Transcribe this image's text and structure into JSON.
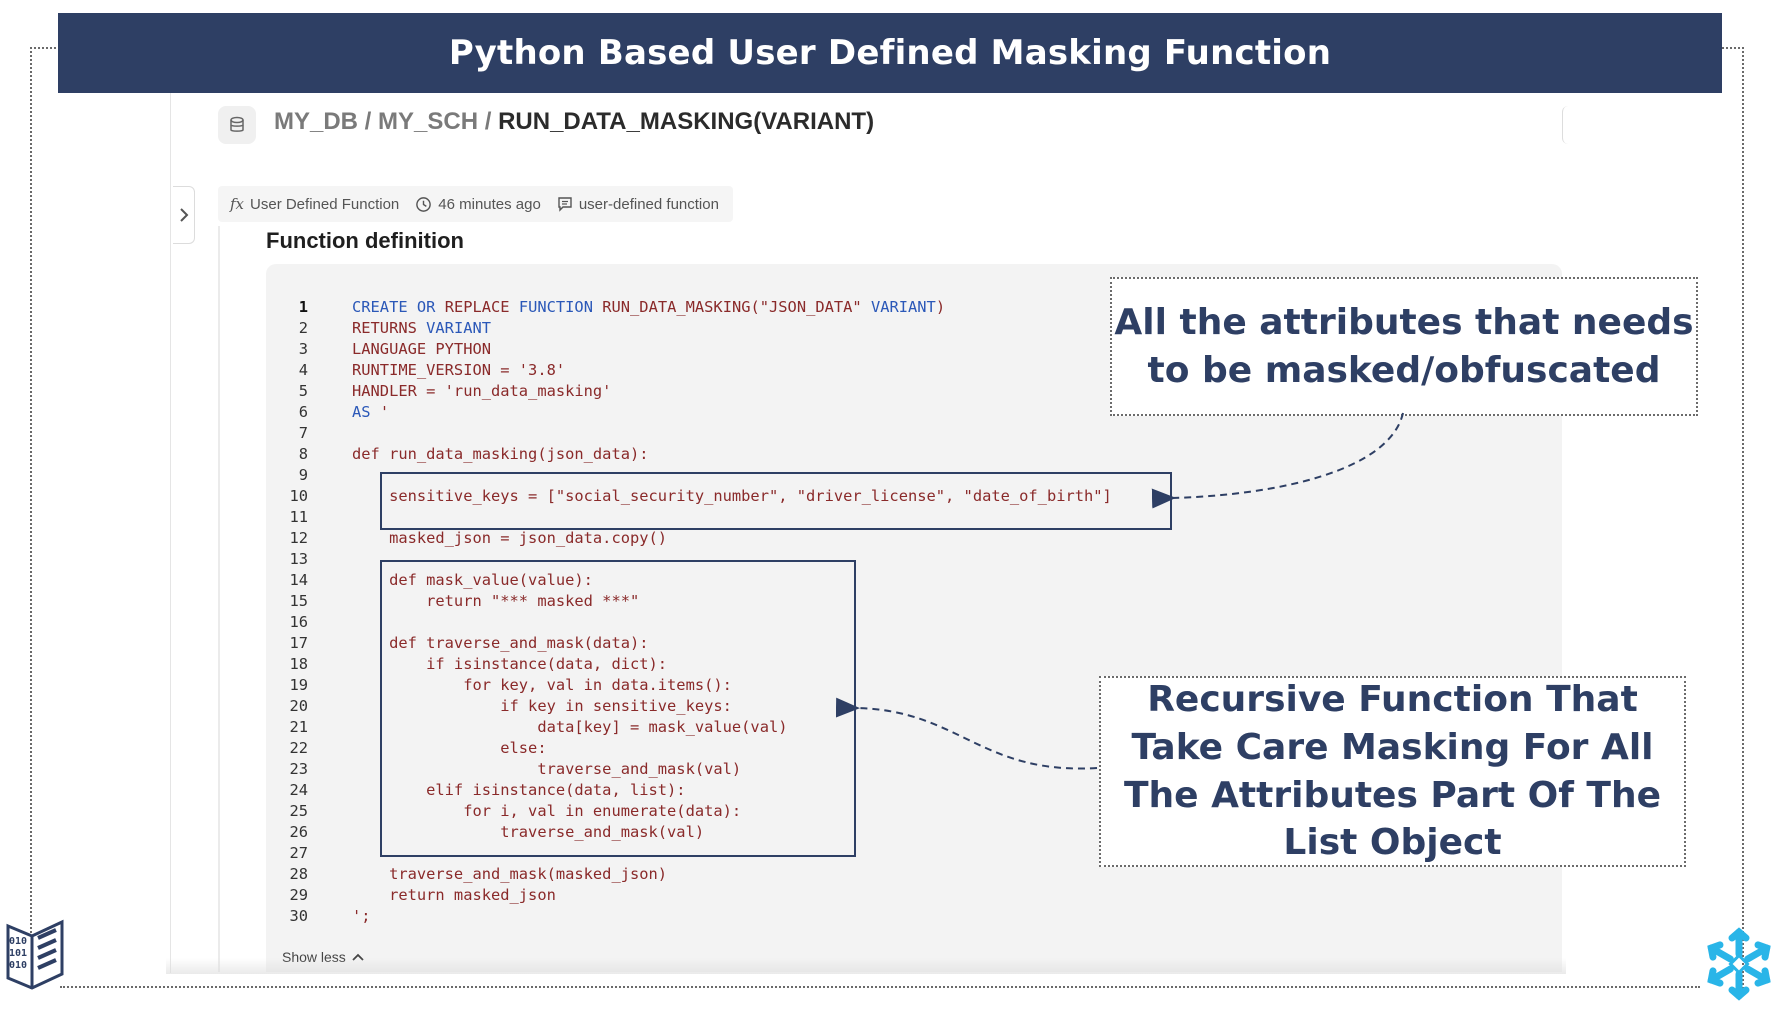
{
  "slide": {
    "title": "Python Based User Defined Masking Function"
  },
  "breadcrumb": {
    "db": "MY_DB",
    "sep1": " / ",
    "schema": "MY_SCH",
    "sep2": " / ",
    "function": "RUN_DATA_MASKING(VARIANT)"
  },
  "meta": {
    "type": "User Defined Function",
    "time": "46 minutes ago",
    "comment": "user-defined function"
  },
  "section_title": "Function definition",
  "code_lines": [
    {
      "n": "1",
      "t": ""
    },
    {
      "n": "2",
      "t": "RETURNS "
    },
    {
      "n": "3",
      "t": "LANGUAGE PYTHON"
    },
    {
      "n": "4",
      "t": "RUNTIME_VERSION = '3.8'"
    },
    {
      "n": "5",
      "t": "HANDLER = 'run_data_masking'"
    },
    {
      "n": "6",
      "t": ""
    },
    {
      "n": "7",
      "t": ""
    },
    {
      "n": "8",
      "t": "def run_data_masking(json_data):"
    },
    {
      "n": "9",
      "t": ""
    },
    {
      "n": "10",
      "t": "    sensitive_keys = [\"social_security_number\", \"driver_license\", \"date_of_birth\"]"
    },
    {
      "n": "11",
      "t": ""
    },
    {
      "n": "12",
      "t": "    masked_json = json_data.copy()"
    },
    {
      "n": "13",
      "t": ""
    },
    {
      "n": "14",
      "t": "    def mask_value(value):"
    },
    {
      "n": "15",
      "t": "        return \"*** masked ***\""
    },
    {
      "n": "16",
      "t": ""
    },
    {
      "n": "17",
      "t": "    def traverse_and_mask(data):"
    },
    {
      "n": "18",
      "t": "        if isinstance(data, dict):"
    },
    {
      "n": "19",
      "t": "            for key, val in data.items():"
    },
    {
      "n": "20",
      "t": "                if key in sensitive_keys:"
    },
    {
      "n": "21",
      "t": "                    data[key] = mask_value(val)"
    },
    {
      "n": "22",
      "t": "                else:"
    },
    {
      "n": "23",
      "t": "                    traverse_and_mask(val)"
    },
    {
      "n": "24",
      "t": "        elif isinstance(data, list):"
    },
    {
      "n": "25",
      "t": "            for i, val in enumerate(data):"
    },
    {
      "n": "26",
      "t": "                traverse_and_mask(val)"
    },
    {
      "n": "27",
      "t": ""
    },
    {
      "n": "28",
      "t": "    traverse_and_mask(masked_json)"
    },
    {
      "n": "29",
      "t": "    return masked_json"
    },
    {
      "n": "30",
      "t": "';"
    }
  ],
  "code_kw": {
    "l1_create": "CREATE",
    "l1_or": " OR ",
    "l1_replace": "REPLACE ",
    "l1_function": "FUNCTION",
    "l1_rest": " RUN_DATA_MASKING(\"JSON_DATA\" ",
    "l1_variant": "VARIANT",
    "l1_close": ")",
    "l2_variant": "VARIANT",
    "l6_as": "AS",
    "l6_quote": " '"
  },
  "show_less": "Show less",
  "callouts": {
    "top": "All the attributes that needs to be masked/obfuscated",
    "bottom": "Recursive Function That Take Care Masking For All The Attributes Part Of The List Object"
  },
  "colors": {
    "title_bg": "#2e3f64",
    "callout_text": "#2e3f64",
    "keyword": "#2b58b8",
    "code_text": "#8a2a2a",
    "snowflake": "#29b5e8"
  }
}
